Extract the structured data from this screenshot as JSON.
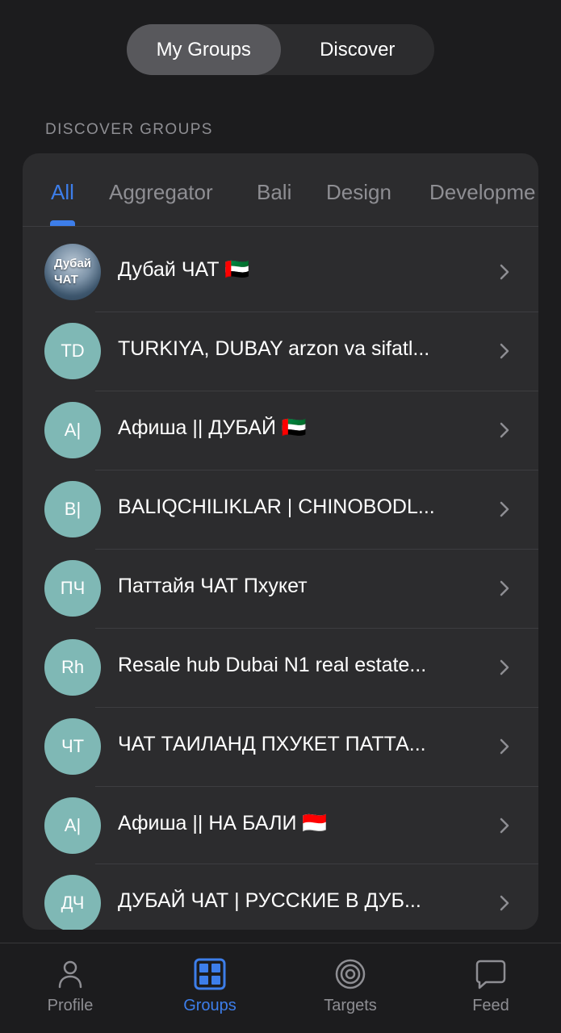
{
  "segmented": {
    "my_groups": "My Groups",
    "discover": "Discover",
    "selected": "My Groups"
  },
  "section_label": "DISCOVER GROUPS",
  "filters": {
    "selected": "All",
    "items": [
      "All",
      "Aggregator",
      "Bali",
      "Design",
      "Developme"
    ]
  },
  "groups": [
    {
      "avatar": "Дубай ЧАТ",
      "title": "Дубай ЧАТ 🇦🇪",
      "avatar_icon": "photo"
    },
    {
      "avatar": "TD",
      "title": "TURKIYA, DUBAY arzon va sifatl..."
    },
    {
      "avatar": "A|",
      "title": "Афиша || ДУБАЙ 🇦🇪"
    },
    {
      "avatar": "B|",
      "title": "BALIQCHILIKLAR | CHINOBODL..."
    },
    {
      "avatar": "ПЧ",
      "title": "Паттайя ЧАТ Пхукет"
    },
    {
      "avatar": "Rh",
      "title": "Resale hub Dubai N1 real estate..."
    },
    {
      "avatar": "ЧТ",
      "title": "ЧАТ ТАИЛАНД ПХУКЕТ ПАТТА..."
    },
    {
      "avatar": "A|",
      "title": "Афиша || НА БАЛИ 🇮🇩"
    },
    {
      "avatar": "ДЧ",
      "title": "ДУБАЙ ЧАТ | РУССКИЕ В ДУБ..."
    }
  ],
  "bottom_nav": {
    "selected": "Groups",
    "items": [
      {
        "label": "Profile",
        "icon": "person-icon"
      },
      {
        "label": "Groups",
        "icon": "grid-icon"
      },
      {
        "label": "Targets",
        "icon": "target-icon"
      },
      {
        "label": "Feed",
        "icon": "chat-bubble-icon"
      }
    ]
  },
  "colors": {
    "background": "#1c1c1e",
    "card": "#2c2c2e",
    "accent": "#3d7eea",
    "avatar": "#7fb8b5",
    "muted": "#8e8e93"
  }
}
